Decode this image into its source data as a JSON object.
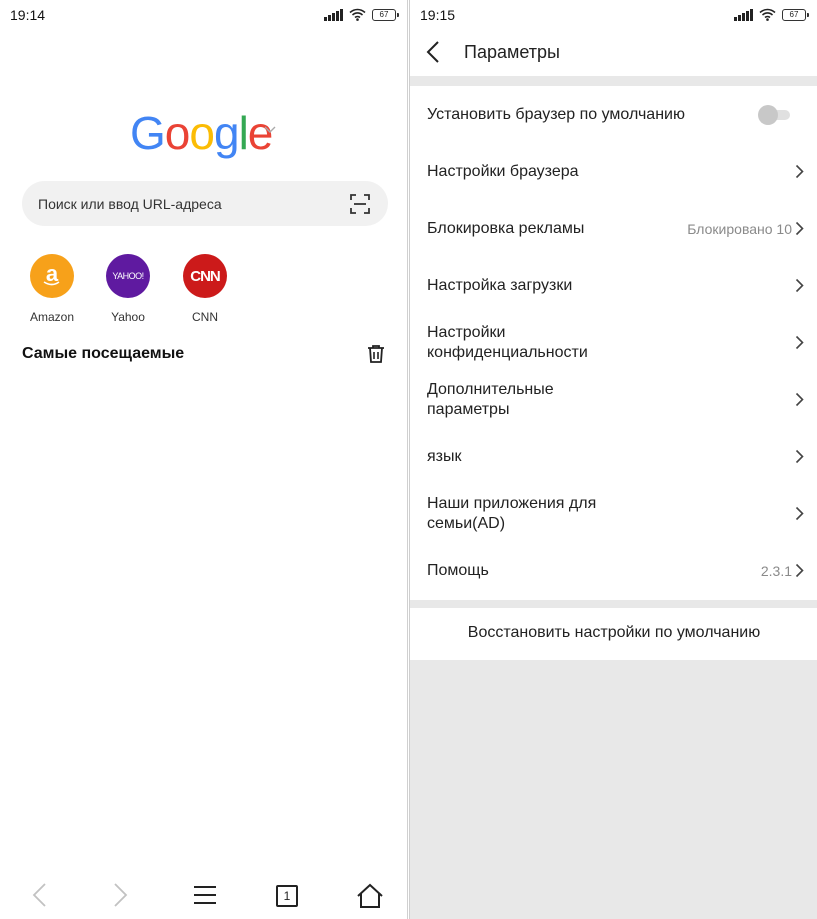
{
  "left": {
    "status": {
      "time": "19:14",
      "battery": "67"
    },
    "logo": {
      "letters": [
        "G",
        "o",
        "o",
        "g",
        "l",
        "e"
      ]
    },
    "search": {
      "placeholder": "Поиск или ввод URL-адреса"
    },
    "speed_dial": [
      {
        "label": "Amazon",
        "icon": "amazon-icon",
        "color": "#f7a11a",
        "glyph": "a"
      },
      {
        "label": "Yahoo",
        "icon": "yahoo-icon",
        "color": "#5f1aa0",
        "glyph": "YAHOO!"
      },
      {
        "label": "CNN",
        "icon": "cnn-icon",
        "color": "#cc1a1a",
        "glyph": "CNN"
      }
    ],
    "most_visited_title": "Самые посещаемые",
    "bottom_nav": {
      "tab_count": "1"
    }
  },
  "right": {
    "status": {
      "time": "19:15",
      "battery": "67"
    },
    "header": {
      "title": "Параметры"
    },
    "settings": [
      {
        "label": "Установить браузер по умолчанию",
        "control": "toggle",
        "enabled": false
      },
      {
        "label": "Настройки браузера",
        "control": "chevron"
      },
      {
        "label": "Блокировка рекламы",
        "value": "Блокировано 10",
        "control": "chevron"
      },
      {
        "label": "Настройка загрузки",
        "control": "chevron"
      },
      {
        "label": "Настройки конфиденциальности",
        "control": "chevron"
      },
      {
        "label": "Дополнительные параметры",
        "control": "chevron"
      },
      {
        "label": "язык",
        "control": "chevron"
      },
      {
        "label": "Наши приложения для семьи(AD)",
        "control": "chevron"
      },
      {
        "label": "Помощь",
        "value": "2.3.1",
        "control": "chevron"
      }
    ],
    "reset_label": "Восстановить настройки по умолчанию"
  },
  "colors": {
    "google_blue": "#4285f4",
    "google_red": "#ea4335",
    "google_yellow": "#fbbc05",
    "google_green": "#34a853",
    "divider_gray": "#e8e8e8"
  }
}
